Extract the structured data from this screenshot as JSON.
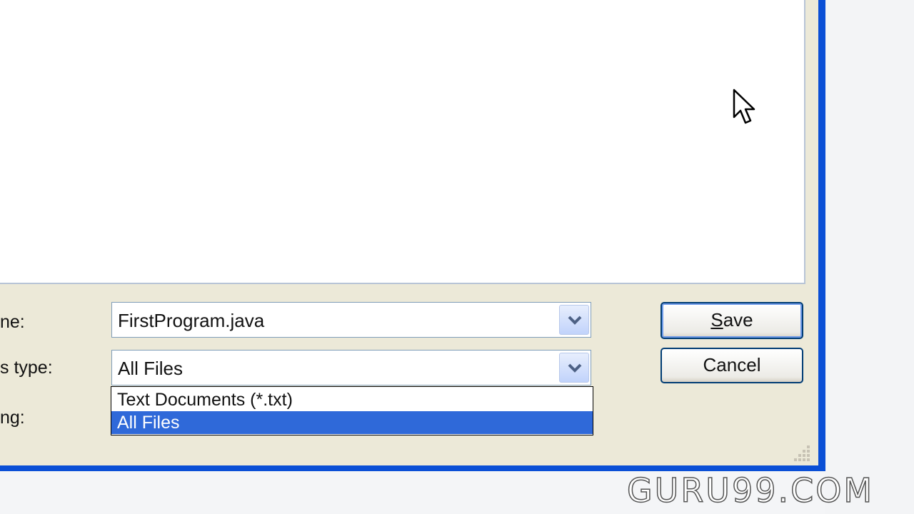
{
  "dialog": {
    "file_name_label": "ne:",
    "save_as_type_label": "s type:",
    "encoding_label": "ng:",
    "file_name_value": "FirstProgram.java",
    "file_type_value": "All Files",
    "dropdown_options": [
      "Text Documents (*.txt)",
      "All Files"
    ],
    "selected_option": "All Files",
    "save_label_first": "S",
    "save_label_rest": "ave",
    "cancel_label": "Cancel"
  },
  "watermark": "GURU99.COM",
  "colors": {
    "frame_blue": "#0a4fd6",
    "selection_blue": "#2f69d9",
    "dialog_bg": "#ece9d8"
  },
  "icons": [
    "chevron-down-icon",
    "mouse-cursor-icon",
    "resize-grip-icon"
  ]
}
